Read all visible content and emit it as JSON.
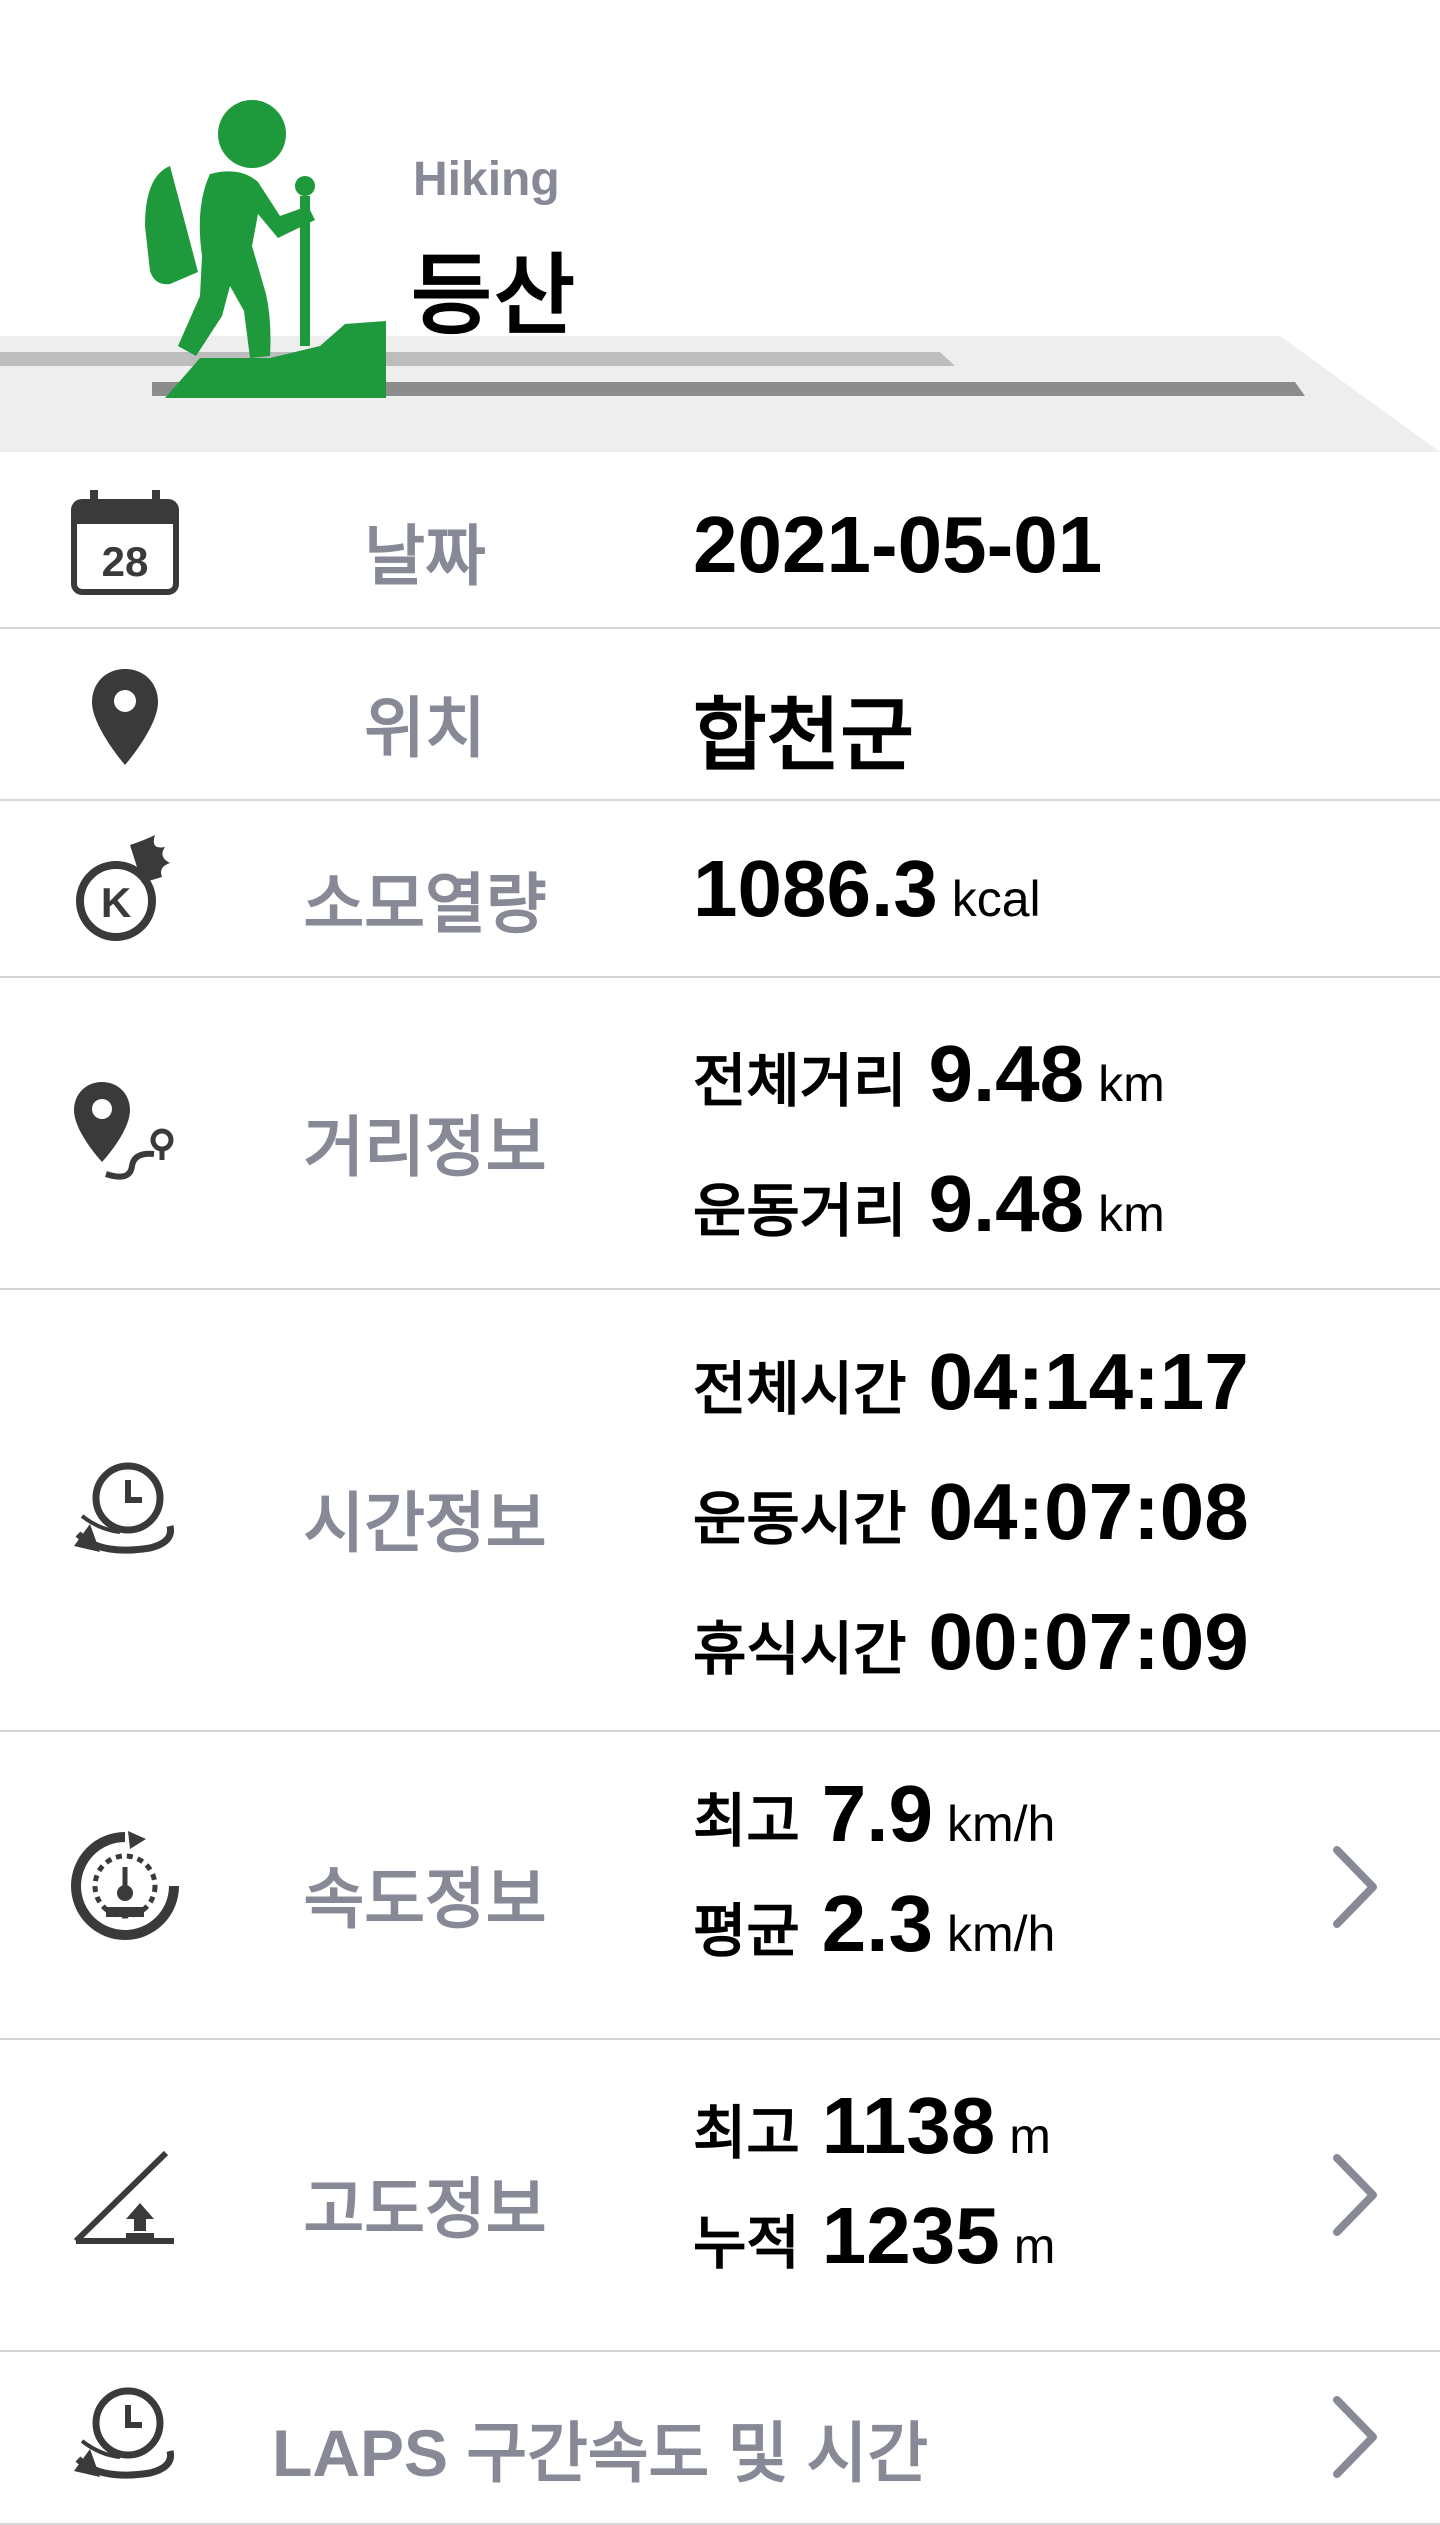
{
  "header": {
    "subtitle": "Hiking",
    "title": "등산",
    "accent_color": "#1e9a3c",
    "hiker_icon": "hiker-icon"
  },
  "rows": {
    "date": {
      "label": "날짜",
      "value": "2021-05-01",
      "icon": "calendar-icon",
      "icon_text": "28"
    },
    "location": {
      "label": "위치",
      "value": "합천군",
      "icon": "location-pin-icon"
    },
    "calories": {
      "label": "소모열량",
      "value": "1086.3",
      "unit": "kcal",
      "icon": "calorie-burn-icon",
      "icon_text": "K"
    },
    "distance": {
      "label": "거리정보",
      "icon": "route-pin-icon",
      "items": [
        {
          "name": "전체거리",
          "value": "9.48",
          "unit": "km"
        },
        {
          "name": "운동거리",
          "value": "9.48",
          "unit": "km"
        }
      ]
    },
    "time": {
      "label": "시간정보",
      "icon": "clock-cycle-icon",
      "items": [
        {
          "name": "전체시간",
          "value": "04:14:17"
        },
        {
          "name": "운동시간",
          "value": "04:07:08"
        },
        {
          "name": "휴식시간",
          "value": "00:07:09"
        }
      ]
    },
    "speed": {
      "label": "속도정보",
      "icon": "speedometer-icon",
      "items": [
        {
          "name": "최고",
          "value": "7.9",
          "unit": "km/h"
        },
        {
          "name": "평균",
          "value": "2.3",
          "unit": "km/h"
        }
      ]
    },
    "altitude": {
      "label": "고도정보",
      "icon": "altitude-slope-icon",
      "items": [
        {
          "name": "최고",
          "value": "1138",
          "unit": "m"
        },
        {
          "name": "누적",
          "value": "1235",
          "unit": "m"
        }
      ]
    },
    "laps": {
      "label": "LAPS 구간속도 및 시간",
      "icon": "laps-clock-icon"
    }
  },
  "colors": {
    "label_gray": "#878a96",
    "divider": "#d6d6d6",
    "icon_dark": "#3a3a3a"
  }
}
